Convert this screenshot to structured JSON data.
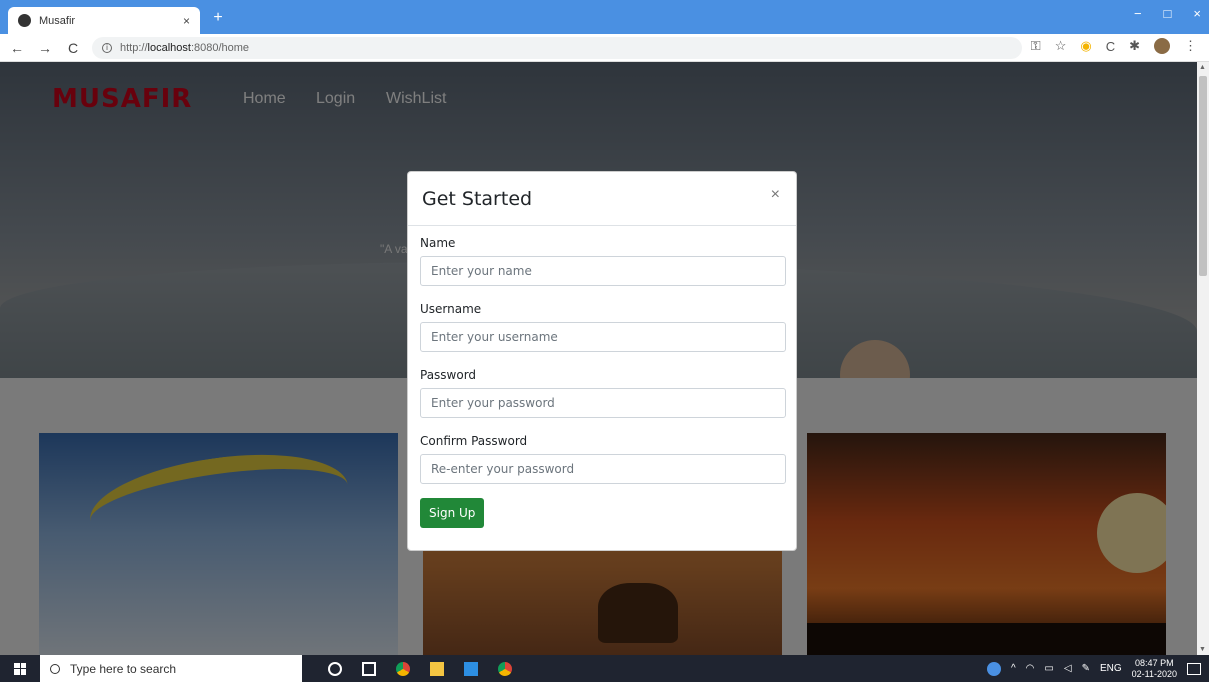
{
  "browser": {
    "tab_title": "Musafir",
    "tab_close": "×",
    "new_tab": "+",
    "url_prefix": "http://",
    "url_host": "localhost",
    "url_rest": ":8080/home",
    "window_controls": [
      "−",
      "□",
      "×"
    ]
  },
  "site": {
    "brand": "MUSAFIR",
    "nav": [
      "Home",
      "Login",
      "WishList"
    ],
    "hero_quote_fragment": "\"A va"
  },
  "modal": {
    "title": "Get Started",
    "close": "×",
    "fields": [
      {
        "label": "Name",
        "placeholder": "Enter your name"
      },
      {
        "label": "Username",
        "placeholder": "Enter your username"
      },
      {
        "label": "Password",
        "placeholder": "Enter your password"
      },
      {
        "label": "Confirm Password",
        "placeholder": "Re-enter your password"
      }
    ],
    "submit_label": "Sign Up"
  },
  "taskbar": {
    "search_placeholder": "Type here to search",
    "language": "ENG",
    "time": "08:47 PM",
    "date": "02-11-2020"
  },
  "colors": {
    "brand_red": "#d0021b",
    "chrome_blue": "#4a90e2",
    "button_green": "#218838"
  }
}
